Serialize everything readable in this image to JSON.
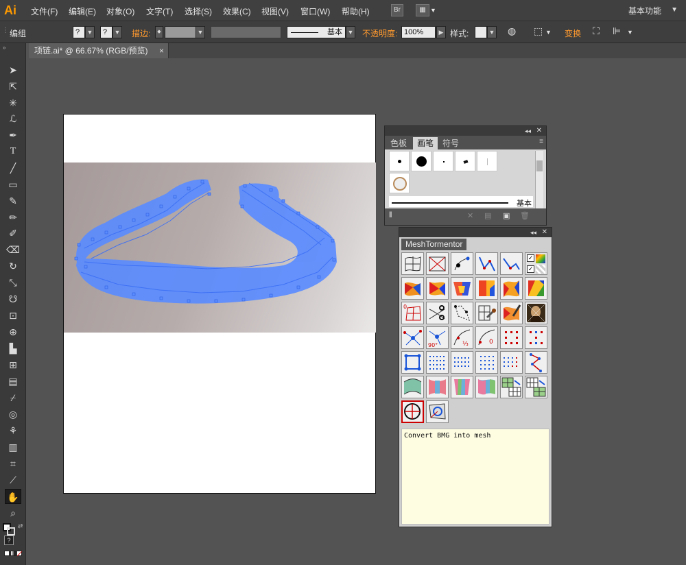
{
  "app": {
    "logo": "Ai"
  },
  "menu": {
    "items": [
      "文件(F)",
      "编辑(E)",
      "对象(O)",
      "文字(T)",
      "选择(S)",
      "效果(C)",
      "视图(V)",
      "窗口(W)",
      "帮助(H)"
    ],
    "bridge_label": "Br",
    "workspace": "基本功能"
  },
  "control_bar": {
    "group_label": "编组",
    "fill_placeholder": "?",
    "stroke_placeholder": "?",
    "stroke_label": "描边:",
    "stroke_style_value": "基本",
    "opacity_label": "不透明度:",
    "opacity_value": "100%",
    "style_label": "样式:",
    "transform_label": "变换"
  },
  "document_tab": {
    "title": "项链.ai* @ 66.67% (RGB/预览)",
    "close": "×"
  },
  "brush_panel": {
    "tabs": [
      "色板",
      "画笔",
      "符号"
    ],
    "active_tab": "画笔",
    "stroke_label": "基本"
  },
  "mesh_panel": {
    "title": "MeshTormentor",
    "description": "Convert BMG into mesh"
  },
  "colors": {
    "selection": "#5b8cff",
    "accent": "#ff9a00"
  }
}
